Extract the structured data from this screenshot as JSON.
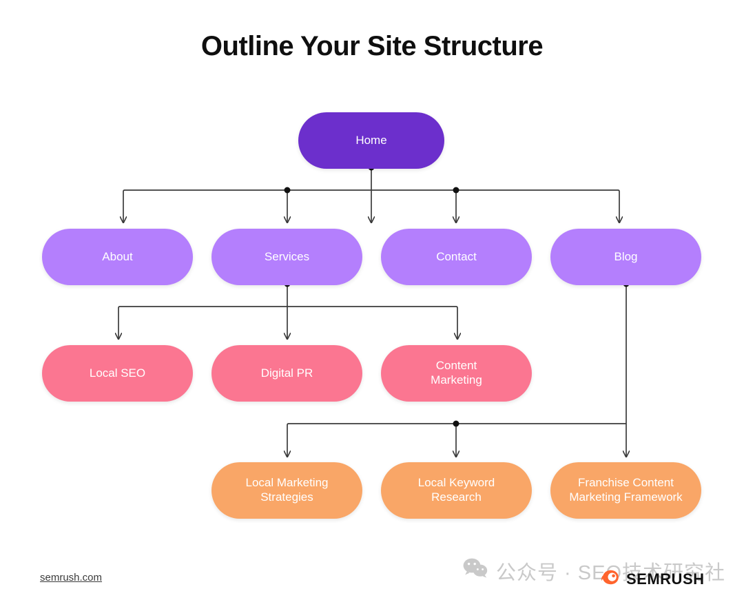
{
  "page": {
    "title": "Outline Your Site Structure",
    "background_color": "#ffffff"
  },
  "colors": {
    "home": "#6C2FCC",
    "level1": "#B47FFD",
    "level2": "#FB7691",
    "level3": "#F9A667",
    "edge": "#3a3a3a",
    "title_text": "#0f0f0f",
    "node_text": "#ffffff",
    "watermark": "#c9c9c9",
    "semrush_orange": "#FF642D"
  },
  "chart_data": {
    "type": "diagram",
    "title": "Outline Your Site Structure",
    "nodes": [
      {
        "id": "home",
        "label": "Home",
        "level": 0,
        "color": "#6C2FCC"
      },
      {
        "id": "about",
        "label": "About",
        "level": 1,
        "color": "#B47FFD"
      },
      {
        "id": "services",
        "label": "Services",
        "level": 1,
        "color": "#B47FFD"
      },
      {
        "id": "contact",
        "label": "Contact",
        "level": 1,
        "color": "#B47FFD"
      },
      {
        "id": "blog",
        "label": "Blog",
        "level": 1,
        "color": "#B47FFD"
      },
      {
        "id": "local-seo",
        "label": "Local SEO",
        "level": 2,
        "color": "#FB7691"
      },
      {
        "id": "digital-pr",
        "label": "Digital PR",
        "level": 2,
        "color": "#FB7691"
      },
      {
        "id": "content-marketing",
        "label": "Content\nMarketing",
        "level": 2,
        "color": "#FB7691"
      },
      {
        "id": "local-marketing-strategies",
        "label": "Local Marketing\nStrategies",
        "level": 3,
        "color": "#F9A667"
      },
      {
        "id": "local-keyword-research",
        "label": "Local Keyword\nResearch",
        "level": 3,
        "color": "#F9A667"
      },
      {
        "id": "franchise-content-marketing-framework",
        "label": "Franchise Content\nMarketing Framework",
        "level": 3,
        "color": "#F9A667"
      }
    ],
    "edges": [
      {
        "from": "home",
        "to": "about"
      },
      {
        "from": "home",
        "to": "services"
      },
      {
        "from": "home",
        "to": "contact"
      },
      {
        "from": "home",
        "to": "blog"
      },
      {
        "from": "services",
        "to": "local-seo"
      },
      {
        "from": "services",
        "to": "digital-pr"
      },
      {
        "from": "services",
        "to": "content-marketing"
      },
      {
        "from": "blog",
        "to": "local-marketing-strategies"
      },
      {
        "from": "blog",
        "to": "local-keyword-research"
      },
      {
        "from": "blog",
        "to": "franchise-content-marketing-framework"
      }
    ]
  },
  "nodes": {
    "home": "Home",
    "about": "About",
    "services": "Services",
    "contact": "Contact",
    "blog": "Blog",
    "local_seo": "Local SEO",
    "digital_pr": "Digital PR",
    "content_marketing": "Content\nMarketing",
    "local_marketing_strategies": "Local Marketing\nStrategies",
    "local_keyword_research": "Local Keyword\nResearch",
    "franchise_content_marketing_framework": "Franchise Content\nMarketing Framework"
  },
  "footer": {
    "source_link": "semrush.com",
    "watermark_text": "公众号 · SEO技术研究社",
    "brand_name": "SEMRUSH"
  }
}
